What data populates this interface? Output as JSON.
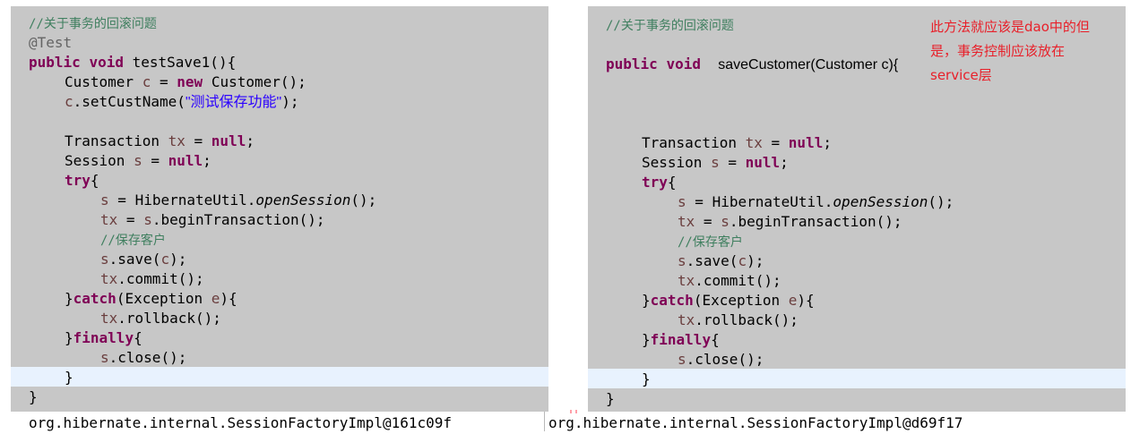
{
  "left_panel": {
    "comment_title": "//关于事务的回滚问题",
    "annotation": "@Test",
    "kw_public": "public",
    "kw_void": "void",
    "method_signature": "testSave1(){",
    "type_customer": "Customer",
    "var_c": "c",
    "op_assign": "=",
    "kw_new": "new",
    "ctor_call": "Customer();",
    "set_name_prefix": "c",
    "set_name_call": ".setCustName(",
    "set_name_arg": "\"测试保存功能\"",
    "set_name_suffix": ");"
  },
  "right_panel": {
    "comment_title": "//关于事务的回滚问题",
    "kw_public": "public",
    "kw_void": "void",
    "method_signature": "saveCustomer(Customer c){",
    "note": "此方法就应该是dao中的但是，事务控制应该放在service层"
  },
  "shared_body": {
    "type_transaction": "Transaction",
    "var_tx": "tx",
    "op_assign": "=",
    "kw_null": "null",
    "semicolon": ";",
    "type_session": "Session",
    "var_s": "s",
    "kw_try": "try",
    "brace_open": "{",
    "hibernate_util": "HibernateUtil.",
    "open_session": "openSession",
    "call_end": "();",
    "begin_tx": ".beginTransaction();",
    "comment_save": "//保存客户",
    "save_call": ".save(",
    "save_end": ");",
    "commit_call": ".commit();",
    "brace_close": "}",
    "kw_catch": "catch",
    "catch_open": "(Exception",
    "var_e": "e",
    "catch_close": "){",
    "rollback_call": ".rollback();",
    "kw_finally": "finally",
    "close_call": ".close();"
  },
  "console": {
    "left_output": "org.hibernate.internal.SessionFactoryImpl@161c09f",
    "right_output": "org.hibernate.internal.SessionFactoryImpl@d69f17"
  }
}
